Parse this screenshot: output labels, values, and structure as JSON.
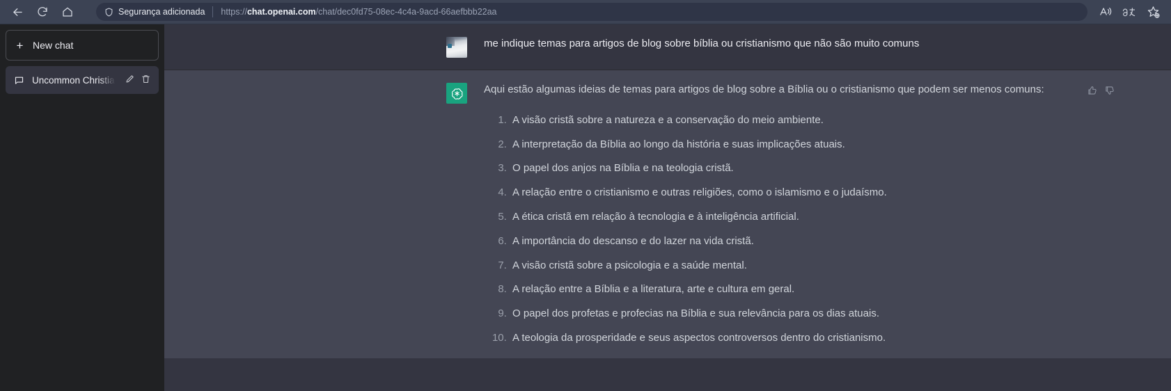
{
  "browser": {
    "back_icon": "back-arrow-icon",
    "refresh_icon": "refresh-icon",
    "home_icon": "home-icon",
    "security_label": "Segurança adicionada",
    "url_scheme": "https://",
    "url_host": "chat.openai.com",
    "url_path": "/chat/dec0fd75-08ec-4c4a-9acd-66aefbbb22aa",
    "url_full": "https://chat.openai.com/chat/dec0fd75-08ec-4c4a-9acd-66aefbbb22aa",
    "actions": [
      {
        "name": "read-aloud-icon",
        "label": "A"
      },
      {
        "name": "translate-icon",
        "label": "aあ"
      },
      {
        "name": "add-favorite-icon",
        "label": "☆"
      }
    ]
  },
  "sidebar": {
    "new_chat_label": "New chat",
    "new_chat_plus": "+",
    "chats": [
      {
        "title": "Uncommon Christian Bl",
        "active": true,
        "edit_icon": "pencil-icon",
        "delete_icon": "trash-icon"
      }
    ]
  },
  "conversation": {
    "messages": [
      {
        "role": "user",
        "avatar": "user-photo-avatar",
        "text": "me indique temas para artigos de blog sobre bíblia ou cristianismo que não são muito comuns"
      },
      {
        "role": "assistant",
        "avatar": "chatgpt-logo-avatar",
        "intro": "Aqui estão algumas ideias de temas para artigos de blog sobre a Bíblia ou o cristianismo que podem ser menos comuns:",
        "list": [
          "A visão cristã sobre a natureza e a conservação do meio ambiente.",
          "A interpretação da Bíblia ao longo da história e suas implicações atuais.",
          "O papel dos anjos na Bíblia e na teologia cristã.",
          "A relação entre o cristianismo e outras religiões, como o islamismo e o judaísmo.",
          "A ética cristã em relação à tecnologia e à inteligência artificial.",
          "A importância do descanso e do lazer na vida cristã.",
          "A visão cristã sobre a psicologia e a saúde mental.",
          "A relação entre a Bíblia e a literatura, arte e cultura em geral.",
          "O papel dos profetas e profecias na Bíblia e sua relevância para os dias atuais.",
          "A teologia da prosperidade e seus aspectos controversos dentro do cristianismo."
        ],
        "actions": [
          {
            "name": "thumbs-up-icon"
          },
          {
            "name": "thumbs-down-icon"
          }
        ]
      }
    ]
  },
  "colors": {
    "browser_chrome": "#3c4354",
    "sidebar_bg": "#202123",
    "user_row_bg": "#343541",
    "assistant_row_bg": "#444654",
    "brand_green": "#19a37f",
    "text_primary": "#ececf1",
    "text_body": "#d1d5db"
  }
}
